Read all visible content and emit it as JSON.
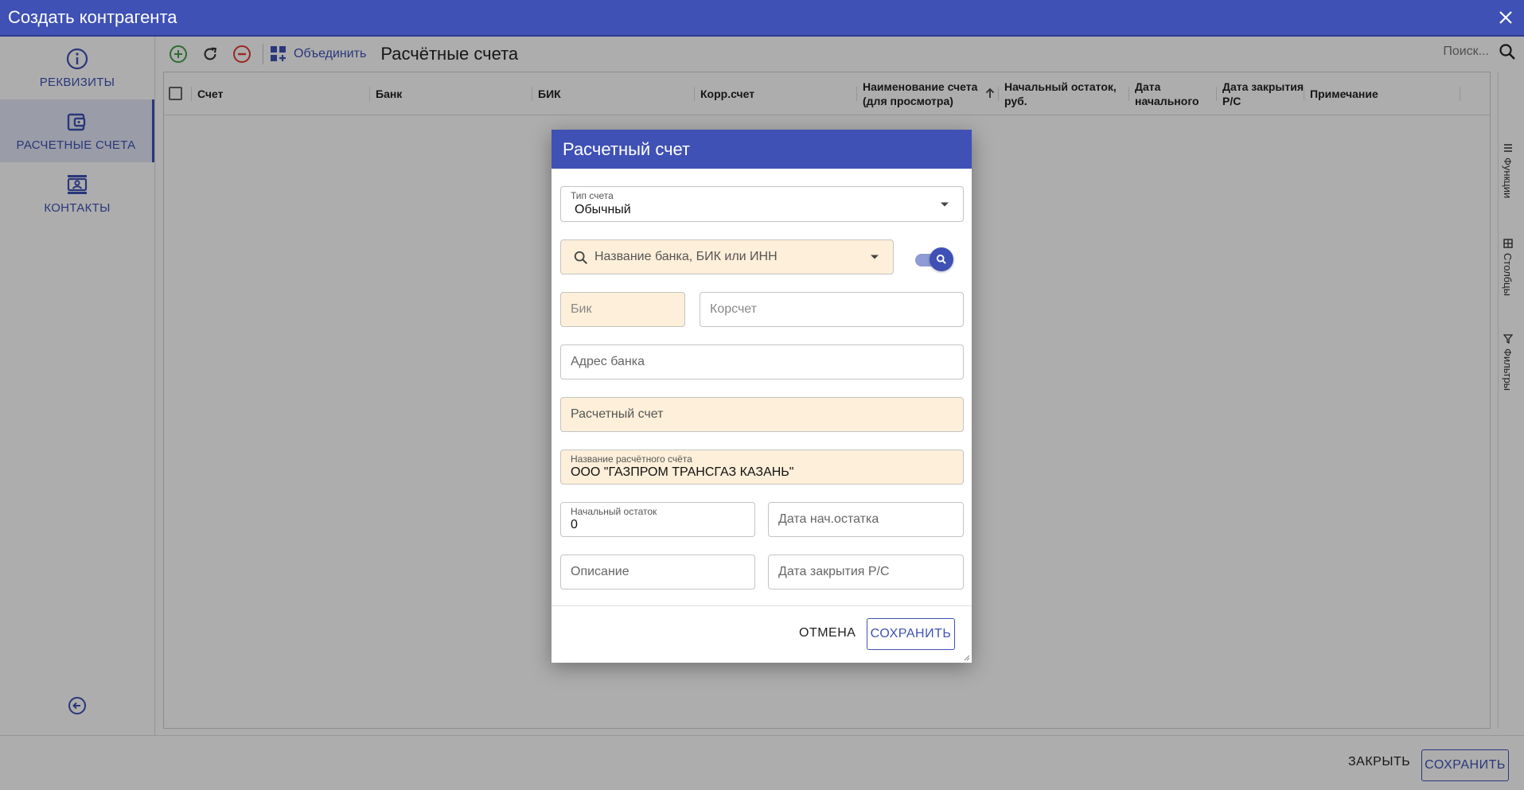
{
  "window": {
    "title": "Создать контрагента"
  },
  "nav": {
    "items": [
      {
        "label": "РЕКВИЗИТЫ",
        "icon": "info-icon"
      },
      {
        "label": "РАСЧЕТНЫЕ СЧЕТА",
        "icon": "wallet-icon"
      },
      {
        "label": "КОНТАКТЫ",
        "icon": "contacts-icon"
      }
    ]
  },
  "toolbar": {
    "merge_label": "Объединить",
    "section_title": "Расчётные счета",
    "search_placeholder": "Поиск..."
  },
  "grid": {
    "columns": [
      "Счет",
      "Банк",
      "БИК",
      "Корр.счет",
      "Наименование счета (для просмотра)",
      "Начальный остаток, руб.",
      "Дата начального",
      "Дата закрытия Р/С",
      "Примечание"
    ]
  },
  "side_tabs": [
    "Функции",
    "Столбцы",
    "Фильтры"
  ],
  "footer": {
    "close_label": "ЗАКРЫТЬ",
    "save_label": "СОХРАНИТЬ"
  },
  "dialog": {
    "title": "Расчетный счет",
    "account_type": {
      "label": "Тип счета",
      "value": "Обычный"
    },
    "bank_search": {
      "placeholder": "Название банка, БИК или ИНН"
    },
    "bik": {
      "placeholder": "Бик"
    },
    "corr": {
      "placeholder": "Корсчет"
    },
    "bank_address": {
      "placeholder": "Адрес банка"
    },
    "account": {
      "placeholder": "Расчетный счет"
    },
    "account_name": {
      "label": "Название расчётного счёта",
      "value": "ООО \"ГАЗПРОМ ТРАНСГАЗ КАЗАНЬ\""
    },
    "opening_balance": {
      "label": "Начальный остаток",
      "value": "0"
    },
    "balance_date": {
      "placeholder": "Дата нач.остатка"
    },
    "description": {
      "placeholder": "Описание"
    },
    "close_date": {
      "placeholder": "Дата закрытия Р/С"
    },
    "cancel_label": "ОТМЕНА",
    "save_label": "СОХРАНИТЬ"
  },
  "colors": {
    "primary": "#3f51b5",
    "required_bg": "#fdefd9",
    "add": "#43a047",
    "remove": "#e53935"
  }
}
